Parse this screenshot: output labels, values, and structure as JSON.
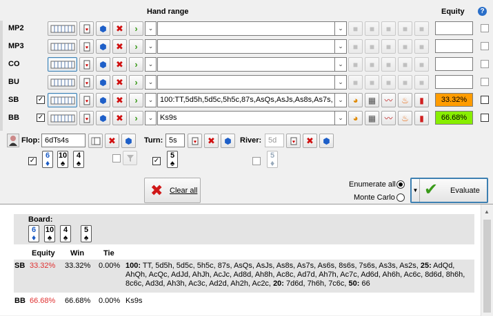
{
  "header": {
    "hand_range": "Hand range",
    "equity": "Equity",
    "help": "?"
  },
  "players": [
    {
      "pos": "MP2",
      "range": "",
      "equity": "",
      "checked": false,
      "selected": false,
      "active": false
    },
    {
      "pos": "MP3",
      "range": "",
      "equity": "",
      "checked": false,
      "selected": false,
      "active": false
    },
    {
      "pos": "CO",
      "range": "",
      "equity": "",
      "checked": false,
      "selected": true,
      "active": false
    },
    {
      "pos": "BU",
      "range": "",
      "equity": "",
      "checked": false,
      "selected": false,
      "active": false
    },
    {
      "pos": "SB",
      "range": "100:TT,5d5h,5d5c,5h5c,87s,AsQs,AsJs,As8s,As7s,",
      "equity": "33.32%",
      "equity_color": "#ff9c00",
      "checked": true,
      "selected": true,
      "active": true
    },
    {
      "pos": "BB",
      "range": "Ks9s",
      "equity": "66.68%",
      "equity_color": "#88ee00",
      "checked": true,
      "selected": false,
      "active": true
    }
  ],
  "board": {
    "flop_label": "Flop:",
    "flop_value": "6dTs4s",
    "turn_label": "Turn:",
    "turn_value": "5s",
    "river_label": "River:",
    "river_value": "5d",
    "flop_cards": [
      {
        "rank": "6",
        "suit": "♦"
      },
      {
        "rank": "10",
        "suit": "♠"
      },
      {
        "rank": "4",
        "suit": "♠"
      }
    ],
    "turn_card": {
      "rank": "5",
      "suit": "♠"
    },
    "river_card": {
      "rank": "5",
      "suit": "♦"
    }
  },
  "actions": {
    "clear_all": "Clear all",
    "enumerate_all": "Enumerate all",
    "monte_carlo": "Monte Carlo",
    "evaluate": "Evaluate"
  },
  "results": {
    "board_label": "Board:",
    "board_cards": [
      {
        "rank": "6",
        "suit": "♦"
      },
      {
        "rank": "10",
        "suit": "♠"
      },
      {
        "rank": "4",
        "suit": "♠"
      },
      {
        "rank": "5",
        "suit": "♠"
      }
    ],
    "col_equity": "Equity",
    "col_win": "Win",
    "col_tie": "Tie",
    "rows": [
      {
        "pos": "SB",
        "equity": "33.32%",
        "win": "33.32%",
        "tie": "0.00%",
        "segments": [
          {
            "w": "100:",
            "t": " TT, 5d5h, 5d5c, 5h5c, 87s, AsQs, AsJs, As8s, As7s, As6s, 8s6s, 7s6s, As3s, As2s, "
          },
          {
            "w": "25:",
            "t": " AdQd, AhQh, AcQc, AdJd, AhJh, AcJc, Ad8d, Ah8h, Ac8c, Ad7d, Ah7h, Ac7c, Ad6d, Ah6h, Ac6c, 8d6d, 8h6h, 8c6c, Ad3d, Ah3h, Ac3c, Ad2d, Ah2h, Ac2c, "
          },
          {
            "w": "20:",
            "t": " 7d6d, 7h6h, 7c6c, "
          },
          {
            "w": "50:",
            "t": " 66"
          }
        ]
      },
      {
        "pos": "BB",
        "equity": "66.68%",
        "win": "66.68%",
        "tie": "0.00%",
        "segments": [
          {
            "w": "",
            "t": "Ks9s"
          }
        ]
      }
    ]
  },
  "colors": {
    "accent": "#3c7fb1",
    "sb_equity": "#ff9c00",
    "bb_equity": "#88ee00",
    "red_text": "#e03030"
  }
}
